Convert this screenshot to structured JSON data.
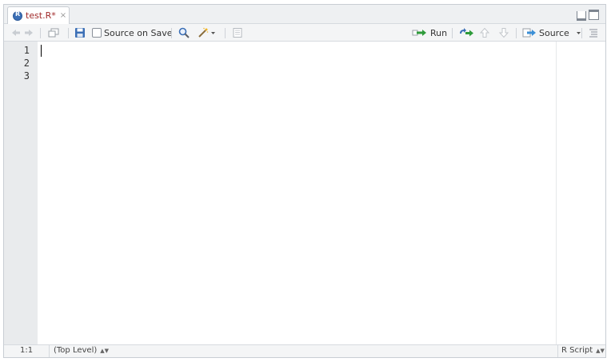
{
  "tab": {
    "filename": "test.R*",
    "close_glyph": "×"
  },
  "toolbar": {
    "source_on_save_label": "Source on Save",
    "run_label": "Run",
    "source_label": "Source"
  },
  "editor": {
    "line_numbers": [
      "1",
      "2",
      "3"
    ]
  },
  "status": {
    "cursor_position": "1:1",
    "scope": "(Top Level)",
    "file_type": "R Script"
  },
  "colors": {
    "accent_green": "#2e9b3a",
    "file_tab_text": "#a02a2a",
    "save_blue": "#3b6fb6"
  }
}
